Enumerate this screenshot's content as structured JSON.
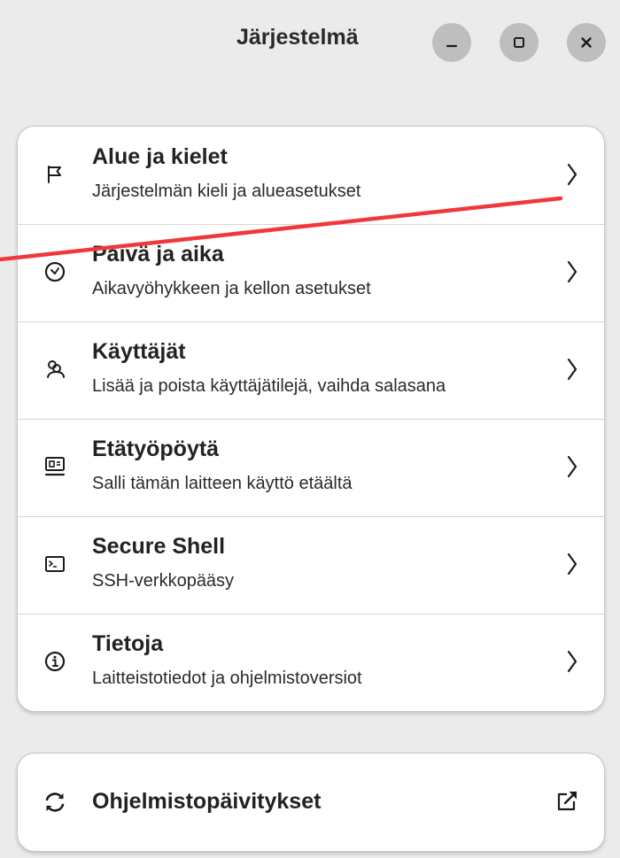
{
  "window": {
    "title": "Järjestelmä",
    "controls": {
      "minimize_icon": "minimize-icon",
      "maximize_icon": "maximize-icon",
      "close_icon": "close-icon"
    }
  },
  "settings": {
    "items": [
      {
        "title": "Alue ja kielet",
        "subtitle": "Järjestelmän kieli ja alueasetukset",
        "icon": "flag-icon"
      },
      {
        "title": "Päivä ja aika",
        "subtitle": "Aikavyöhykkeen ja kellon asetukset",
        "icon": "clock-icon"
      },
      {
        "title": "Käyttäjät",
        "subtitle": "Lisää ja poista käyttäjätilejä, vaihda salasana",
        "icon": "users-icon"
      },
      {
        "title": "Etätyöpöytä",
        "subtitle": "Salli tämän laitteen käyttö etäältä",
        "icon": "remote-desktop-icon"
      },
      {
        "title": "Secure Shell",
        "subtitle": "SSH-verkkopääsy",
        "icon": "terminal-icon"
      },
      {
        "title": "Tietoja",
        "subtitle": "Laitteistotiedot ja ohjelmistoversiot",
        "icon": "info-icon"
      }
    ]
  },
  "updates": {
    "title": "Ohjelmistopäivitykset",
    "icon": "refresh-icon",
    "action_icon": "external-link-icon"
  },
  "colors": {
    "background": "#ebebeb",
    "card": "#ffffff",
    "window_button": "#bebebe",
    "annotation": "#f0383c"
  }
}
